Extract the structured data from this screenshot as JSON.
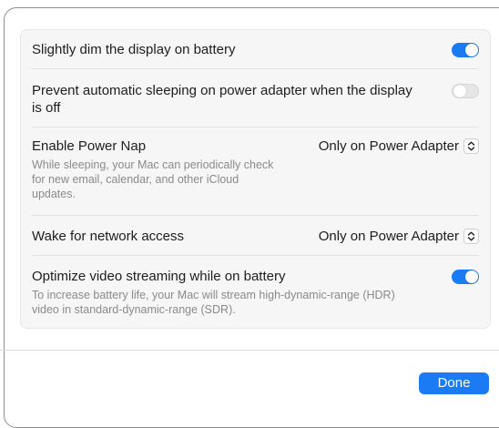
{
  "settings": {
    "dim_display": {
      "label": "Slightly dim the display on battery",
      "enabled": true
    },
    "prevent_sleep": {
      "label": "Prevent automatic sleeping on power adapter when the display is off",
      "enabled": false
    },
    "power_nap": {
      "label": "Enable Power Nap",
      "description": "While sleeping, your Mac can periodically check for new email, calendar, and other iCloud updates.",
      "value": "Only on Power Adapter"
    },
    "wake_network": {
      "label": "Wake for network access",
      "value": "Only on Power Adapter"
    },
    "optimize_video": {
      "label": "Optimize video streaming while on battery",
      "description": "To increase battery life, your Mac will stream high-dynamic-range (HDR) video in standard-dynamic-range (SDR).",
      "enabled": true
    }
  },
  "footer": {
    "done_label": "Done"
  },
  "colors": {
    "accent": "#1a7bf5",
    "secondary_text": "#8a8a8a"
  }
}
